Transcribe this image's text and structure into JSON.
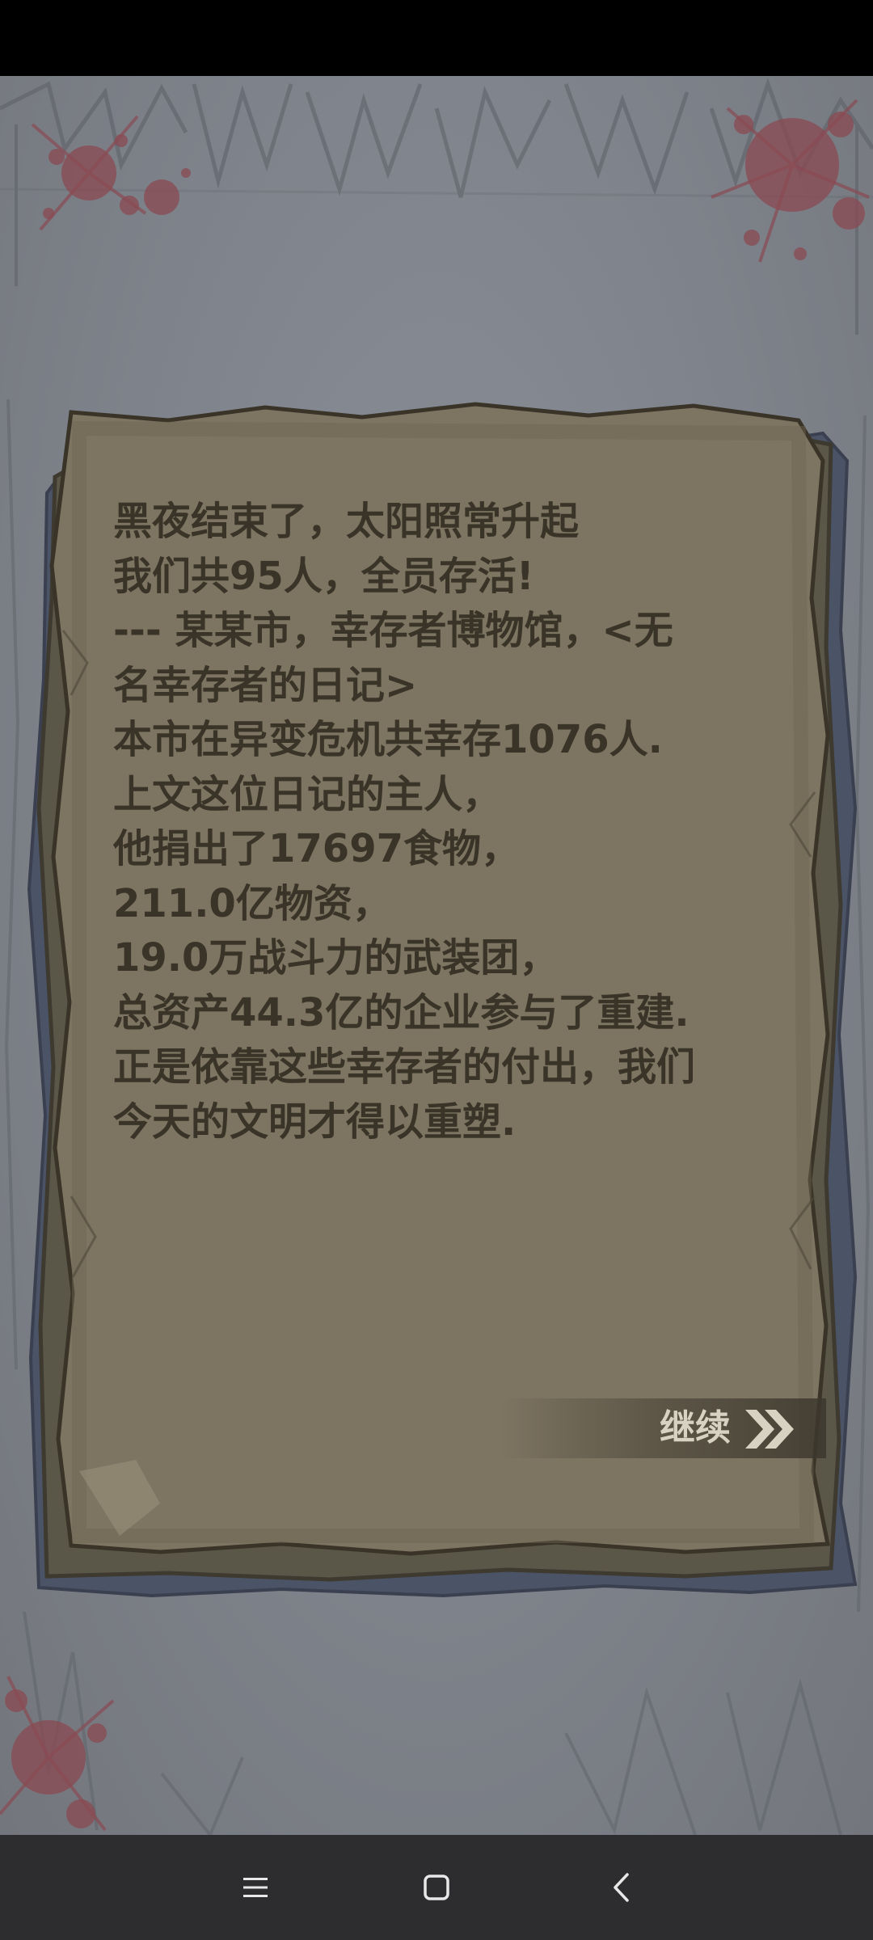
{
  "diary": {
    "lines": [
      "黑夜结束了，太阳照常升起",
      "我们共95人，全员存活!",
      "---  某某市，幸存者博物馆，<无",
      "名幸存者的日记>",
      "本市在异变危机共幸存1076人.",
      "上文这位日记的主人，",
      "他捐出了17697食物，",
      "211.0亿物资，",
      "19.0万战斗力的武装团，",
      "总资产44.3亿的企业参与了重建.",
      "正是依靠这些幸存者的付出，我们",
      "今天的文明才得以重塑."
    ]
  },
  "continue_button": {
    "label": "继续",
    "icon": "double-chevron-right-icon"
  },
  "nav": {
    "menu_icon": "menu-icon",
    "home_icon": "home-icon",
    "back_icon": "back-icon"
  },
  "colors": {
    "paper": "#7d7461",
    "paper_edge": "#4a4a5a",
    "text": "#3a3428",
    "background": "#80848c",
    "blood": "#8a4a52",
    "nav_bar": "#2d2d2f"
  }
}
